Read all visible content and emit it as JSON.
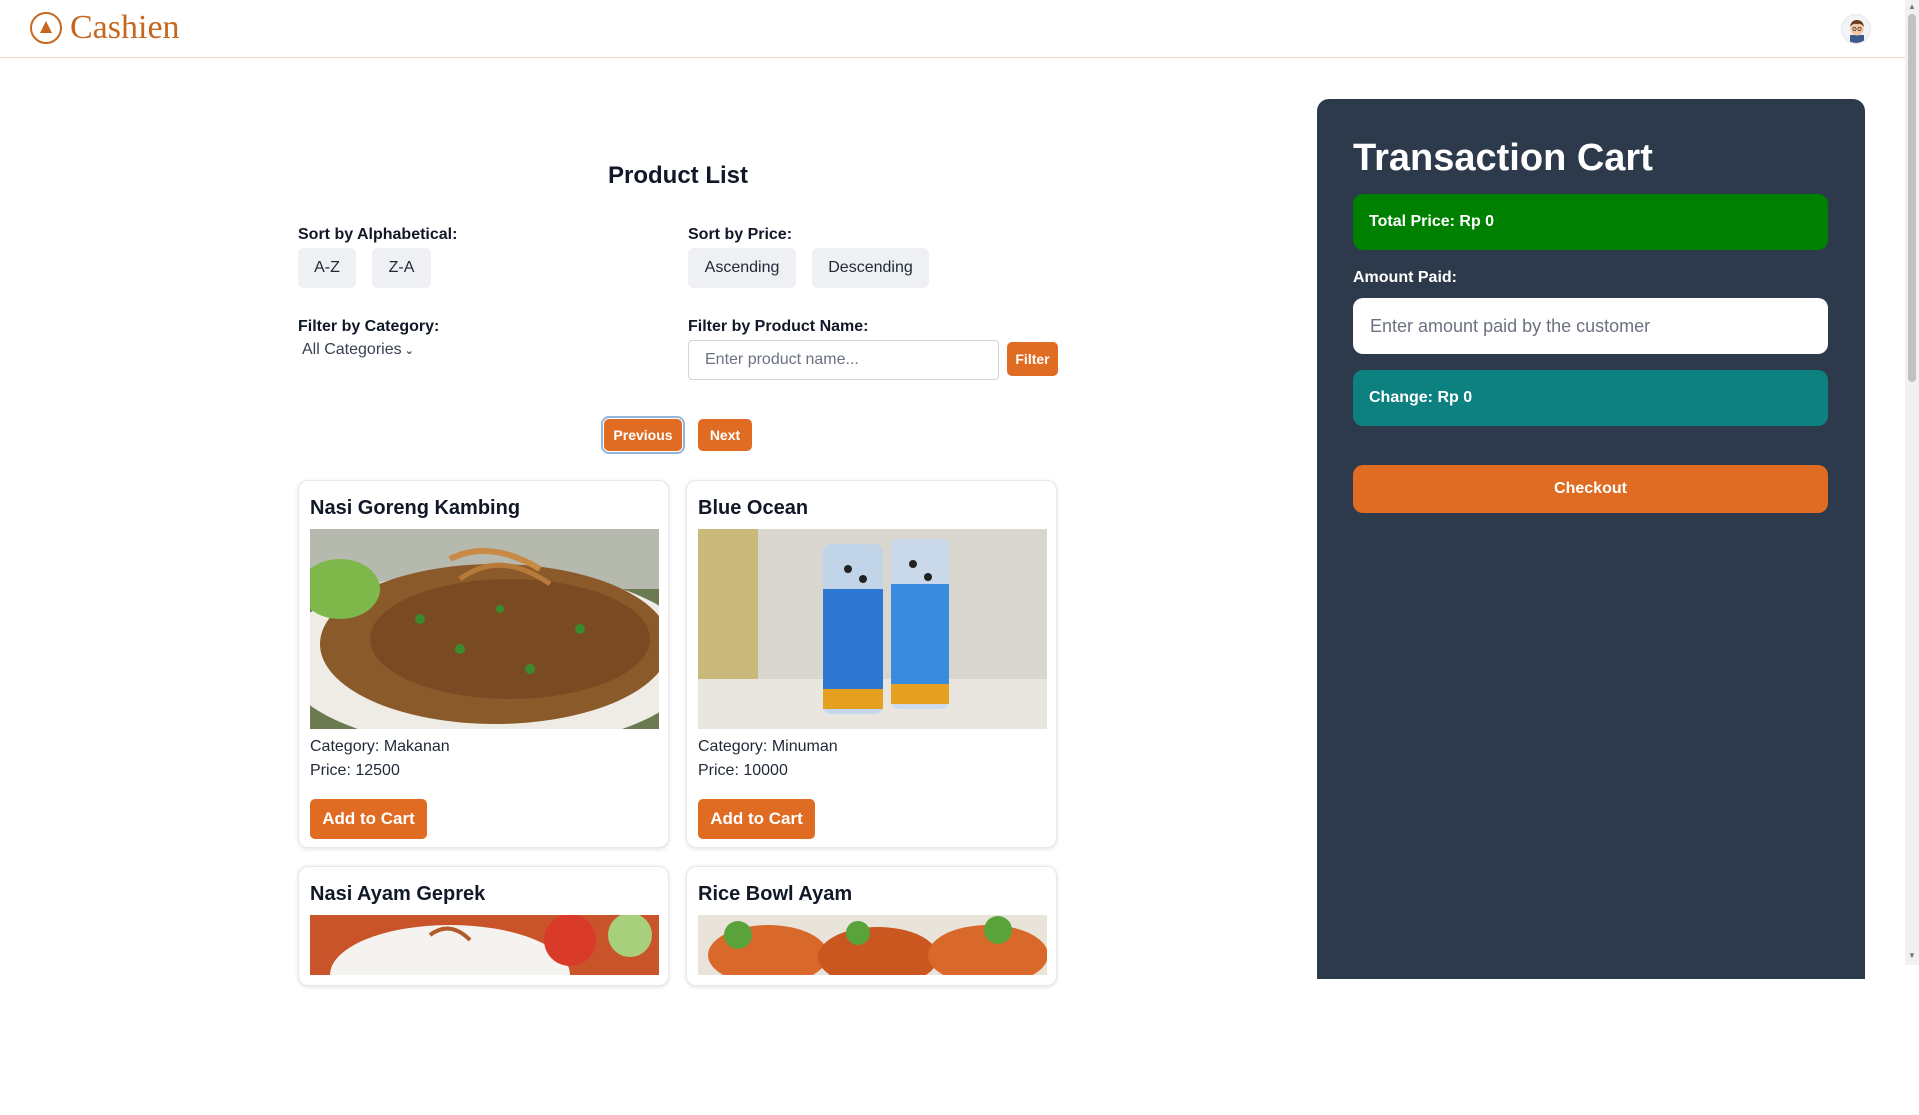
{
  "header": {
    "app_name": "Cashien",
    "logo_icon": "cashien-logo-icon",
    "avatar_icon": "user-avatar-icon"
  },
  "product_list": {
    "title": "Product List",
    "sort_alpha": {
      "label": "Sort by Alphabetical:",
      "options": [
        "A-Z",
        "Z-A"
      ]
    },
    "sort_price": {
      "label": "Sort by Price:",
      "options": [
        "Ascending",
        "Descending"
      ]
    },
    "filter_category": {
      "label": "Filter by Category:",
      "selected": "All Categories"
    },
    "filter_name": {
      "label": "Filter by Product Name:",
      "placeholder": "Enter product name...",
      "button": "Filter"
    },
    "pagination": {
      "previous": "Previous",
      "next": "Next"
    },
    "products": [
      {
        "name": "Nasi Goreng Kambing",
        "category": "Category: Makanan",
        "price": "Price: 12500",
        "button": "Add to Cart"
      },
      {
        "name": "Blue Ocean",
        "category": "Category: Minuman",
        "price": "Price: 10000",
        "button": "Add to Cart"
      },
      {
        "name": "Nasi Ayam Geprek",
        "category": "",
        "price": "",
        "button": ""
      },
      {
        "name": "Rice Bowl Ayam",
        "category": "",
        "price": "",
        "button": ""
      }
    ]
  },
  "cart": {
    "title": "Transaction Cart",
    "total": "Total Price: Rp 0",
    "amount_label": "Amount Paid:",
    "amount_placeholder": "Enter amount paid by the customer",
    "change": "Change: Rp 0",
    "checkout": "Checkout"
  },
  "colors": {
    "accent": "#e06b22",
    "total_bg": "#008000",
    "change_bg": "#0d8080",
    "cart_bg": "#2d3a4b"
  }
}
